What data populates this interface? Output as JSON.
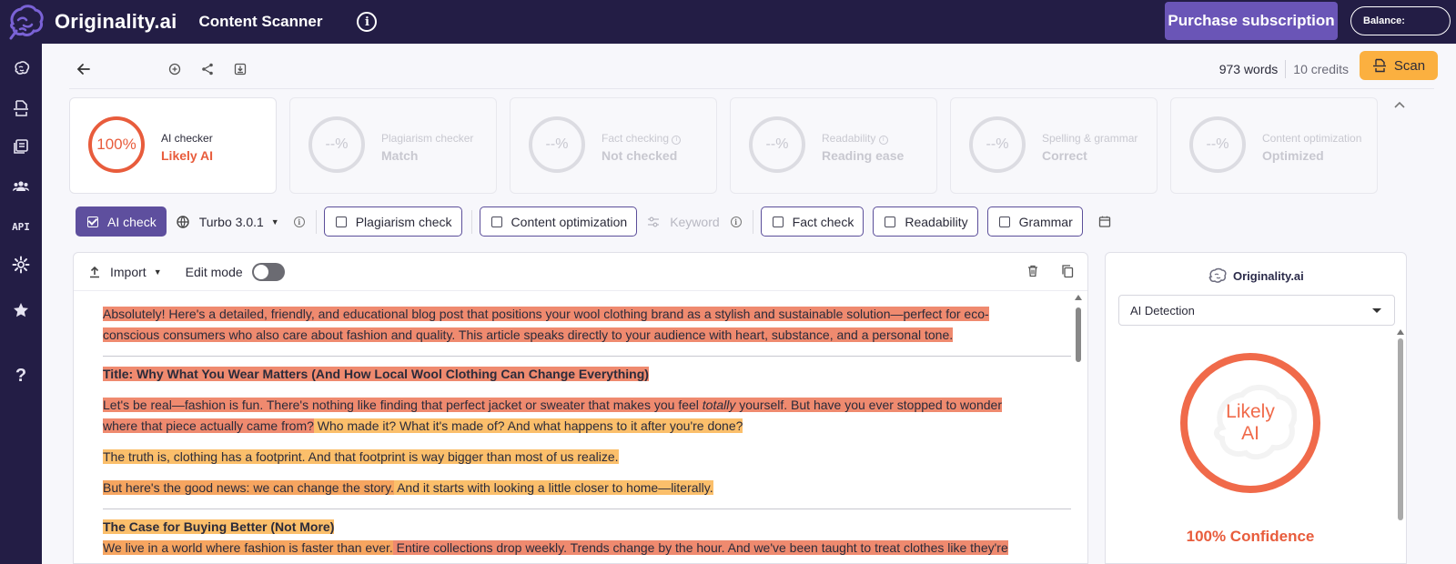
{
  "header": {
    "brand": "Originality.ai",
    "app_title": "Content Scanner",
    "info_icon": "info-circle-icon",
    "purchase_label": "Purchase subscription",
    "balance_label": "Balance:"
  },
  "sidebar": {
    "items": [
      {
        "icon": "brain-icon"
      },
      {
        "icon": "document-scan-icon"
      },
      {
        "icon": "library-icon"
      },
      {
        "icon": "team-icon"
      },
      {
        "label": "API"
      },
      {
        "icon": "settings-icon"
      },
      {
        "icon": "star-icon"
      },
      {
        "label": "?"
      }
    ]
  },
  "toolbar": {
    "words": "973 words",
    "credits": "10 credits",
    "scan_label": "Scan"
  },
  "cards": [
    {
      "percent": "100%",
      "label": "AI checker",
      "value": "Likely AI",
      "active": true
    },
    {
      "percent": "--%",
      "label": "Plagiarism checker",
      "value": "Match",
      "active": false
    },
    {
      "percent": "--%",
      "label": "Fact checking",
      "value": "Not checked",
      "active": false
    },
    {
      "percent": "--%",
      "label": "Readability",
      "value": "Reading ease",
      "active": false
    },
    {
      "percent": "--%",
      "label": "Spelling & grammar",
      "value": "Correct",
      "active": false
    },
    {
      "percent": "--%",
      "label": "Content optimization",
      "value": "Optimized",
      "active": false
    }
  ],
  "checks": {
    "ai_check": "AI check",
    "model": "Turbo 3.0.1",
    "plagiarism": "Plagiarism check",
    "content_optimization": "Content optimization",
    "keyword": "Keyword",
    "fact_check": "Fact check",
    "readability": "Readability",
    "grammar": "Grammar"
  },
  "editor": {
    "import_label": "Import",
    "edit_mode_label": "Edit mode",
    "edit_mode_on": false,
    "paragraphs": [
      {
        "style": "r",
        "lines": [
          "Absolutely!  Here's a detailed, friendly, and educational blog post that positions your wool clothing brand as a stylish and sustainable solution—perfect for eco-",
          "conscious consumers who also care about fashion and quality.  This article speaks directly to your audience with heart, substance, and a personal tone."
        ]
      },
      {
        "style": "r",
        "heading": true,
        "lines": [
          " Title: Why What You Wear Matters (And How Local Wool Clothing Can Change Everything) "
        ]
      },
      {
        "style": "r",
        "lines": [
          "Let's be real—fashion is fun.  There's nothing like finding that perfect jacket or sweater that makes you feel totally yourself.  But have you ever stopped to wonder",
          "where that piece actually came from?  Who made it?  What it's made of?  And what happens to it after you're done?"
        ]
      },
      {
        "style": "o",
        "lines": [
          "The truth is, clothing has a footprint.  And that footprint is way bigger than most of us realize."
        ]
      },
      {
        "style": "o",
        "lines": [
          "But here's the good news: we can change the story.  And it starts with looking a little closer to home—literally."
        ]
      },
      {
        "style": "o",
        "heading": true,
        "lines": [
          "The Case for Buying Better (Not More)"
        ]
      },
      {
        "style": "r",
        "lines": [
          "We live in a world where fashion is faster than ever.  Entire collections drop weekly.  Trends change by the hour.  And we've been taught to treat clothes like they're"
        ]
      }
    ]
  },
  "panel": {
    "brand": "Originality.ai",
    "select_value": "AI Detection",
    "ring_line1": "Likely",
    "ring_line2": "AI",
    "ai_score": 1.0,
    "confidence": "100% Confidence"
  },
  "colors": {
    "brand_dark": "#231d45",
    "accent_purple": "#6a55b7",
    "ai_red": "#e85c3c",
    "scan_orange": "#fbb040"
  }
}
